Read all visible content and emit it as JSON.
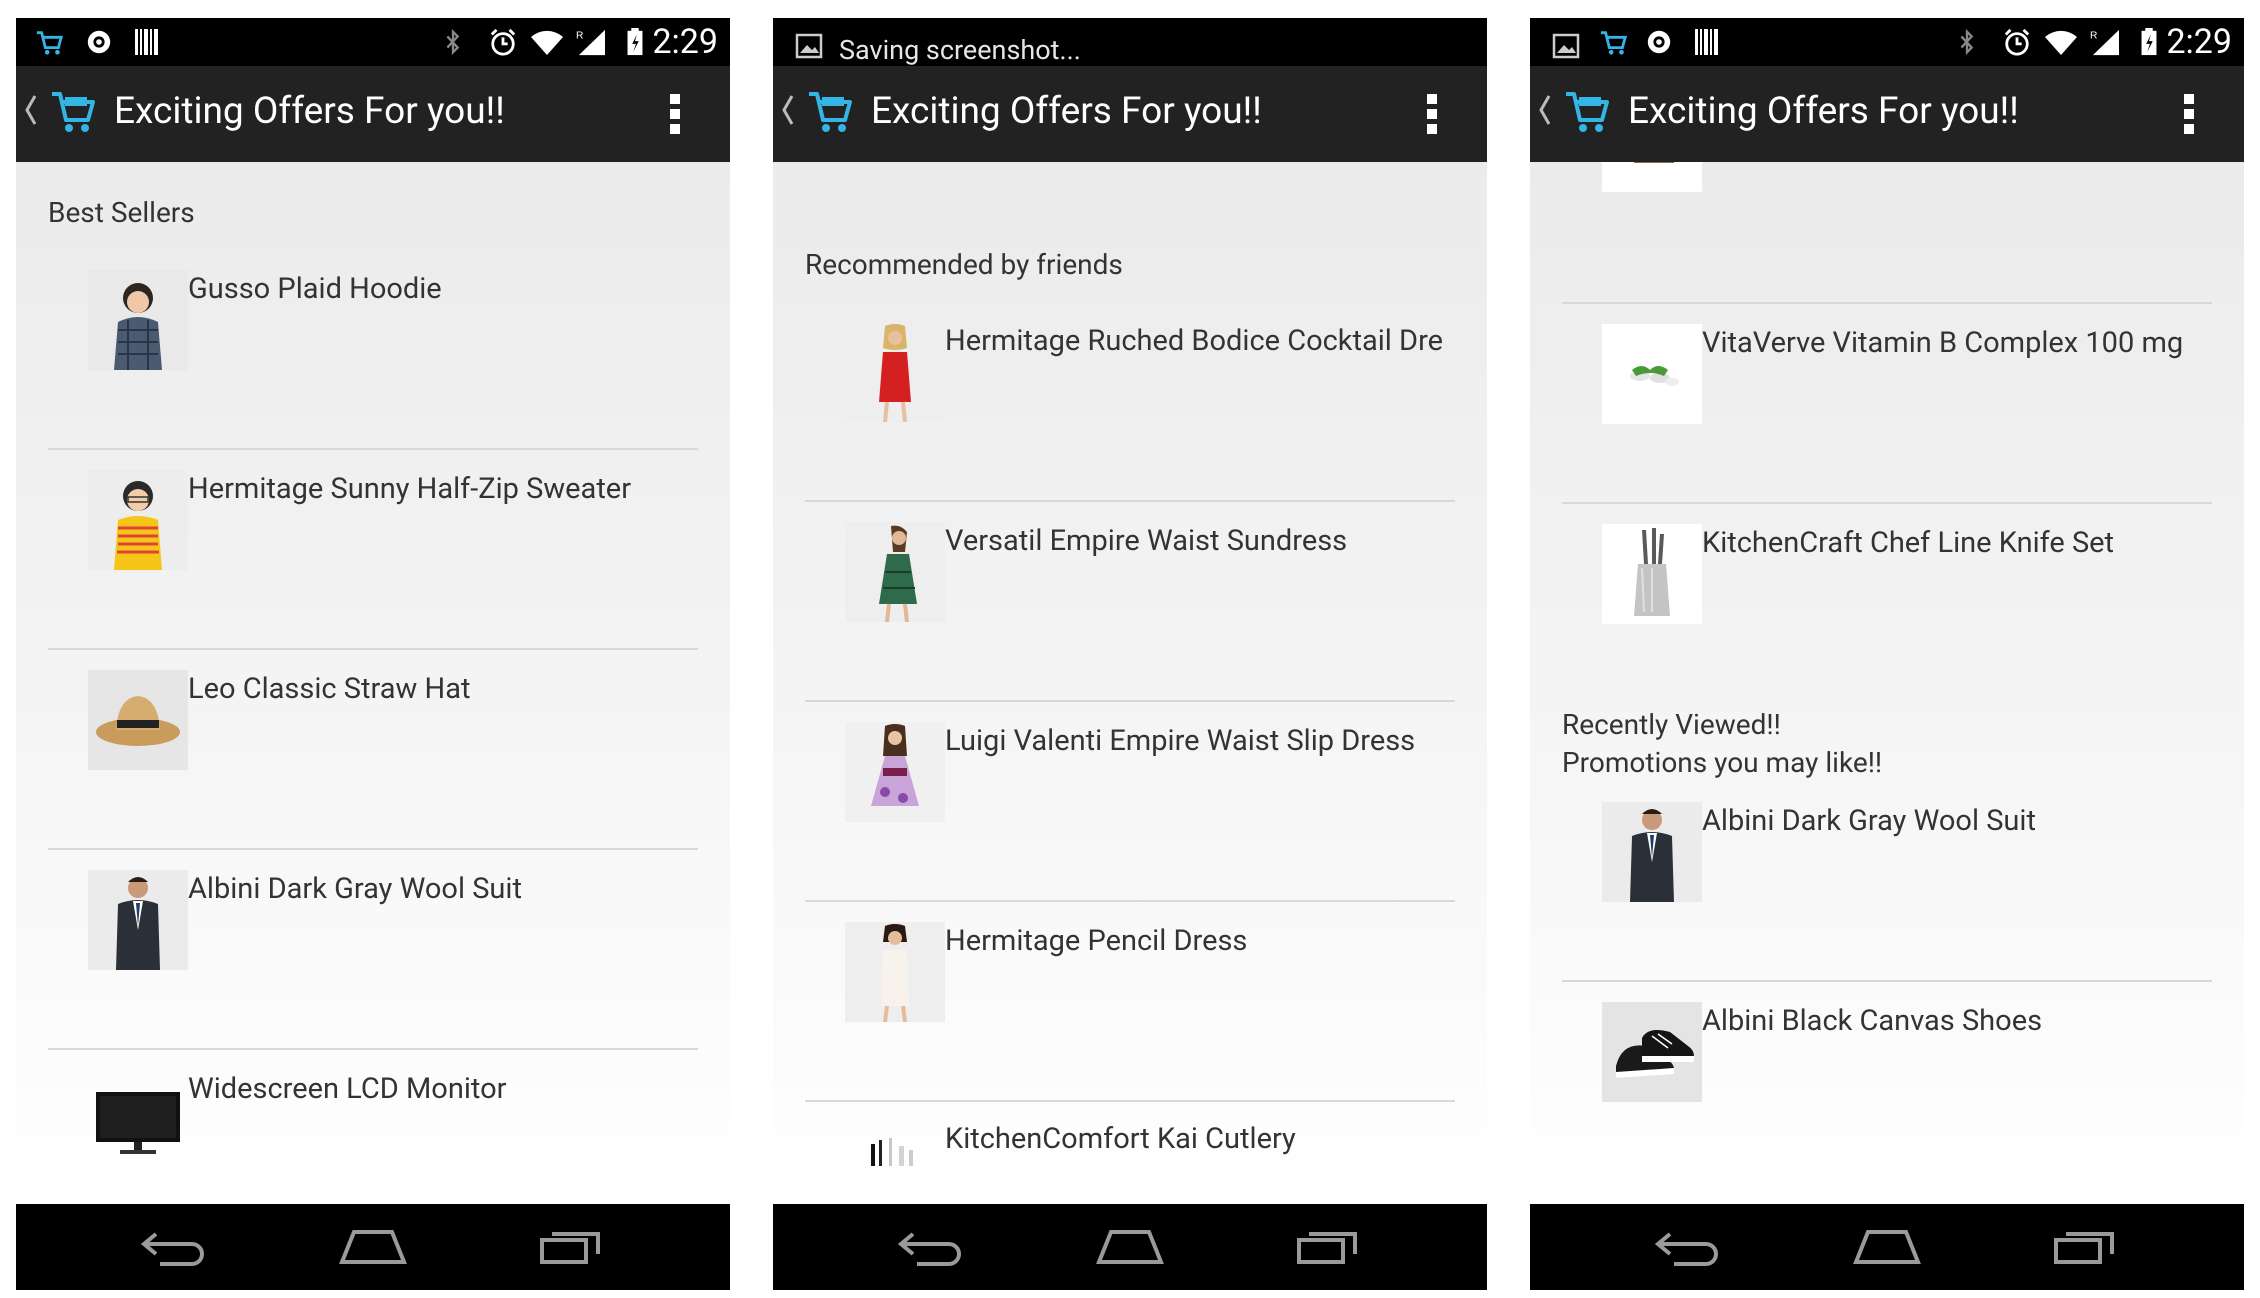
{
  "colors": {
    "status_bar": "#000000",
    "action_bar": "#222222",
    "content_bg": "#ebebeb",
    "divider": "#d8d8d8",
    "text": "#333333"
  },
  "icons": [
    "cart-icon",
    "overflow-menu-icon",
    "up-caret-icon",
    "back-icon",
    "home-icon",
    "recent-apps-icon",
    "bluetooth-icon",
    "alarm-icon",
    "wifi-icon",
    "cell-signal-icon",
    "battery-icon",
    "screenshot-icon"
  ],
  "screens": [
    {
      "status": {
        "time": "2:29"
      },
      "title": "Exciting Offers For you!!",
      "section": "Best Sellers",
      "items": [
        {
          "name": "Gusso Plaid Hoodie",
          "image": "child-plaid-hoodie"
        },
        {
          "name": "Hermitage Sunny Half-Zip Sweater",
          "image": "child-striped-sweater"
        },
        {
          "name": "Leo Classic Straw Hat",
          "image": "straw-hat"
        },
        {
          "name": "Albini Dark Gray Wool Suit",
          "image": "man-suit"
        },
        {
          "name": "Widescreen LCD Monitor",
          "image": "lcd-monitor"
        }
      ]
    },
    {
      "status": {
        "notification": "Saving screenshot..."
      },
      "title": "Exciting Offers For you!!",
      "section": "Recommended by friends",
      "items": [
        {
          "name": "Hermitage Ruched Bodice Cocktail Dre",
          "image": "red-dress"
        },
        {
          "name": "Versatil Empire Waist Sundress",
          "image": "green-sundress"
        },
        {
          "name": "Luigi Valenti Empire Waist Slip Dress",
          "image": "floral-slip-dress"
        },
        {
          "name": "Hermitage Pencil Dress",
          "image": "white-pencil-dress"
        },
        {
          "name": "KitchenComfort Kai Cutlery",
          "image": "cutlery"
        }
      ]
    },
    {
      "status": {
        "time": "2:29"
      },
      "title": "Exciting Offers For you!!",
      "items": [
        {
          "name": "VitaVerve Vitamin B Complex 100 mg",
          "image": "vitamin-pills"
        },
        {
          "name": "KitchenCraft Chef Line Knife Set",
          "image": "knife-block"
        }
      ],
      "section_recent": "Recently Viewed!!",
      "section_promo": "Promotions you may like!!",
      "promos": [
        {
          "name": "Albini Dark Gray Wool Suit",
          "image": "man-suit"
        },
        {
          "name": "Albini Black Canvas Shoes",
          "image": "canvas-shoes"
        }
      ]
    }
  ]
}
